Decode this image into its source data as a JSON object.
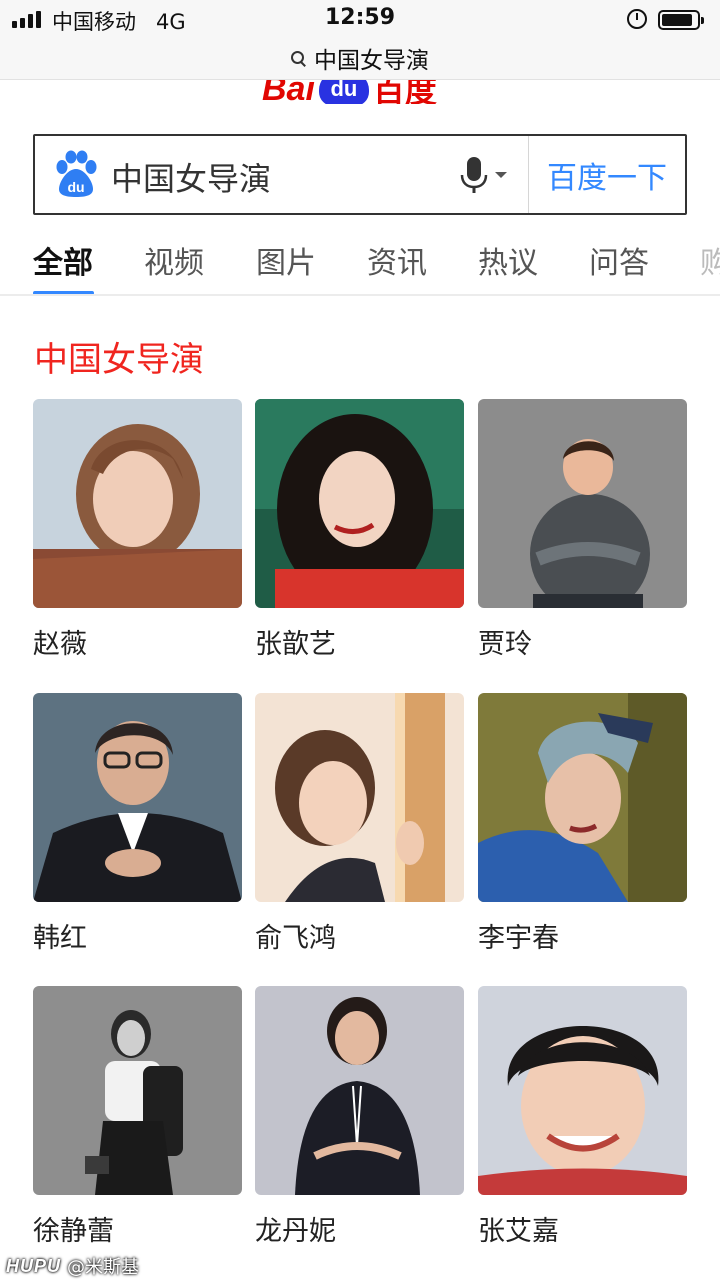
{
  "status_bar": {
    "carrier": "中国移动",
    "network": "4G",
    "time": "12:59"
  },
  "url_bar": {
    "query": "中国女导演",
    "icon": "search-icon"
  },
  "logo": {
    "latin": "Bai",
    "badge": "du",
    "chinese": "百度"
  },
  "search": {
    "query": "中国女导演",
    "button_label": "百度一下",
    "icons": [
      "baidu-paw-icon",
      "microphone-icon",
      "chevron-down-icon"
    ]
  },
  "tabs": [
    {
      "label": "全部",
      "active": true
    },
    {
      "label": "视频",
      "active": false
    },
    {
      "label": "图片",
      "active": false
    },
    {
      "label": "资讯",
      "active": false
    },
    {
      "label": "热议",
      "active": false
    },
    {
      "label": "问答",
      "active": false
    },
    {
      "label": "购",
      "active": false
    }
  ],
  "result": {
    "title": "中国女导演",
    "directors": [
      {
        "name": "赵薇"
      },
      {
        "name": "张歆艺"
      },
      {
        "name": "贾玲"
      },
      {
        "name": "韩红"
      },
      {
        "name": "俞飞鸿"
      },
      {
        "name": "李宇春"
      },
      {
        "name": "徐静蕾"
      },
      {
        "name": "龙丹妮"
      },
      {
        "name": "张艾嘉"
      }
    ]
  },
  "watermark": {
    "logo": "HUPU",
    "author": "@米斯基"
  },
  "colors": {
    "accent_blue": "#3388ff",
    "result_red": "#f0251f",
    "baidu_red": "#e10602",
    "baidu_blue": "#2932e1"
  }
}
